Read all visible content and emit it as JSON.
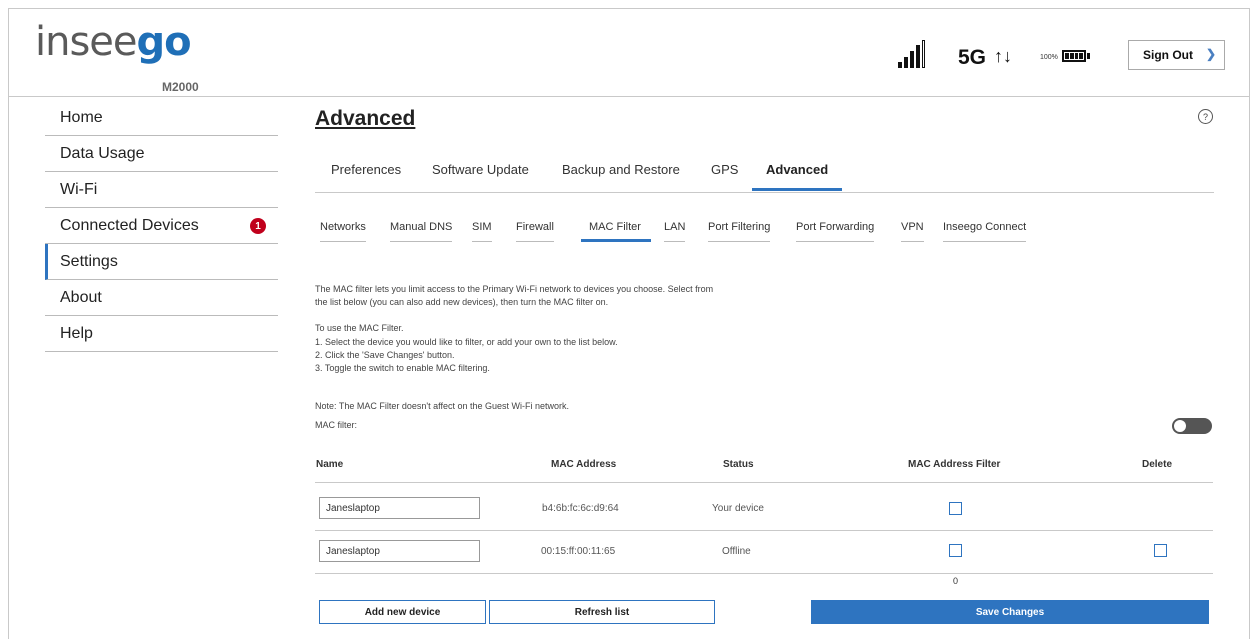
{
  "header": {
    "logo_light": "insee",
    "logo_bold": "go",
    "model": "M2000",
    "network": "5G",
    "arrows": "↑↓",
    "battery": "100%",
    "signout_label": "Sign Out"
  },
  "sidebar": {
    "items": [
      {
        "label": "Home"
      },
      {
        "label": "Data Usage"
      },
      {
        "label": "Wi-Fi"
      },
      {
        "label": "Connected Devices",
        "badge": "1"
      },
      {
        "label": "Settings"
      },
      {
        "label": "About"
      },
      {
        "label": "Help"
      }
    ],
    "active": "Settings"
  },
  "main": {
    "title": "Advanced",
    "help_glyph": "?",
    "tabs": [
      "Preferences",
      "Software Update",
      "Backup and Restore",
      "GPS",
      "Advanced"
    ],
    "active_tab": "Advanced",
    "subtabs": [
      "Networks",
      "Manual DNS",
      "SIM",
      "Firewall",
      "MAC Filter",
      "LAN",
      "Port Filtering",
      "Port Forwarding",
      "VPN",
      "Inseego Connect"
    ],
    "active_subtab": "MAC Filter",
    "intro_line1": "The MAC filter lets you limit access to the Primary Wi-Fi network to devices you choose. Select from",
    "intro_line2": "the list below (you can also add new devices), then turn the MAC filter on.",
    "howto_title": "To use the MAC Filter.",
    "step1": "1. Select the device you would like to filter, or add your own to the list below.",
    "step2": "2. Click the 'Save Changes' button.",
    "step3": "3. Toggle the switch to enable MAC filtering.",
    "note": "Note: The MAC Filter doesn't affect on the Guest Wi-Fi network.",
    "mac_filter_label": "MAC filter:",
    "mac_filter_enabled": false
  },
  "table": {
    "headers": {
      "name": "Name",
      "mac": "MAC Address",
      "status": "Status",
      "filter": "MAC Address Filter",
      "delete": "Delete"
    },
    "rows": [
      {
        "name": "Janeslaptop",
        "mac": "b4:6b:fc:6c:d9:64",
        "status": "Your device",
        "filter_checked": false,
        "delete": false
      },
      {
        "name": "Janeslaptop",
        "mac": "00:15:ff:00:11:65",
        "status": "Offline",
        "filter_checked": false,
        "delete": true
      }
    ],
    "count": "0"
  },
  "buttons": {
    "add": "Add new device",
    "refresh": "Refresh list",
    "save": "Save Changes"
  },
  "colors": {
    "accent": "#2e74c0",
    "badge": "#c0001c",
    "logo_blue": "#1f6fb7"
  }
}
